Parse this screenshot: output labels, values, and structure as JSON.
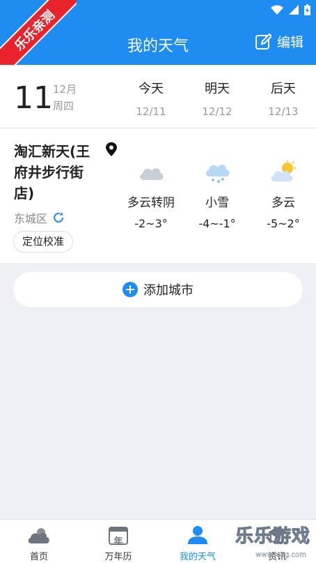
{
  "header": {
    "title": "我的天气",
    "edit_label": "编辑",
    "badge": "乐乐亲测"
  },
  "date": {
    "day": "11",
    "month": "12月",
    "weekday": "周四",
    "columns": [
      {
        "label": "今天",
        "date": "12/11"
      },
      {
        "label": "明天",
        "date": "12/12"
      },
      {
        "label": "后天",
        "date": "12/13"
      }
    ]
  },
  "city": {
    "name": "淘汇新天(王府井步行街店)",
    "district": "东城区",
    "calibrate": "定位校准",
    "forecast": [
      {
        "icon": "cloudy-icon",
        "condition": "多云转阴",
        "temp": "-2~3°"
      },
      {
        "icon": "snow-icon",
        "condition": "小雪",
        "temp": "-4~-1°"
      },
      {
        "icon": "partly-cloudy-icon",
        "condition": "多云",
        "temp": "-5~2°"
      }
    ]
  },
  "add_city": "添加城市",
  "nav": [
    {
      "label": "首页",
      "icon": "home-weather-icon"
    },
    {
      "label": "万年历",
      "icon": "calendar-icon",
      "glyph": "年"
    },
    {
      "label": "我的天气",
      "icon": "user-icon"
    },
    {
      "label": "资讯",
      "icon": "news-icon"
    }
  ],
  "watermark": {
    "text": "乐乐游戏",
    "url": "www.leeg.com"
  },
  "colors": {
    "accent": "#1f8cf1",
    "badge": "#e8232b"
  }
}
